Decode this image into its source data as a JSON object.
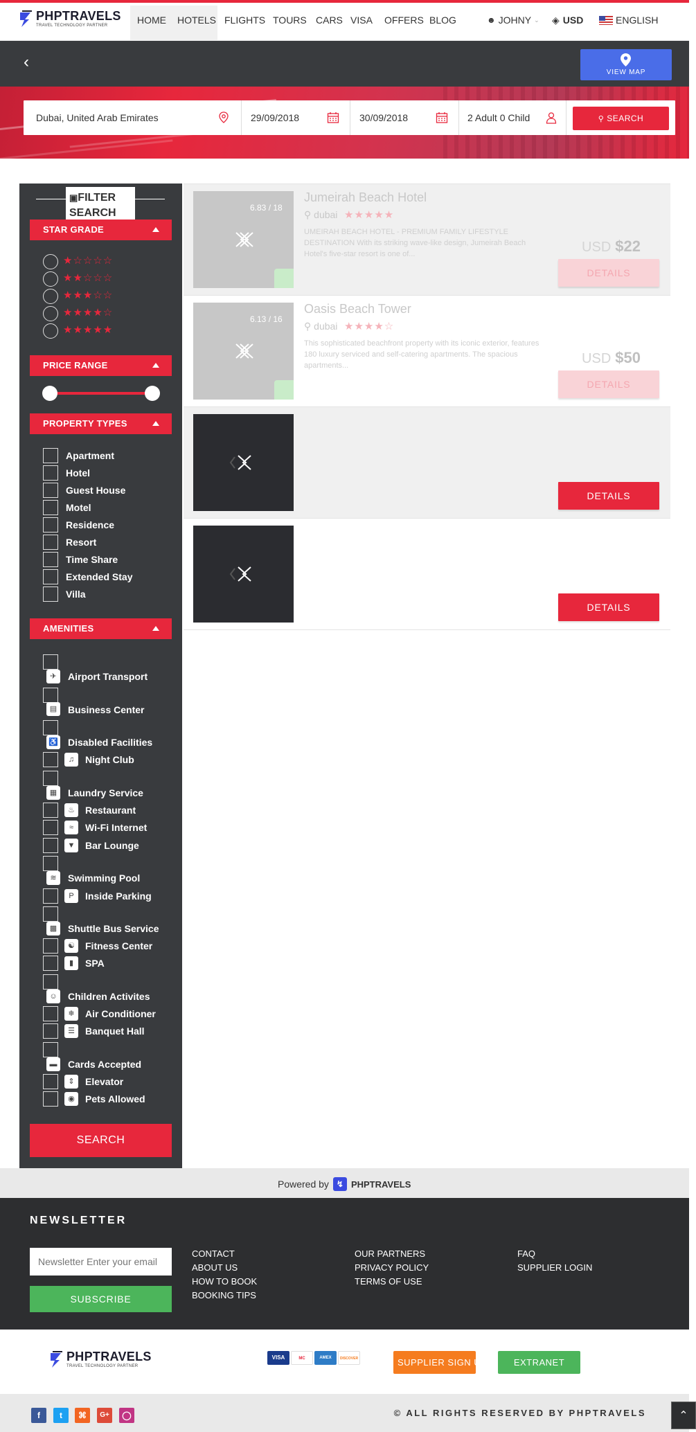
{
  "brand": {
    "name": "PHPTRAVELS",
    "tagline": "TRAVEL TECHNOLOGY PARTNER"
  },
  "nav": {
    "items": [
      "HOME",
      "HOTELS",
      "FLIGHTS",
      "TOURS",
      "CARS",
      "VISA",
      "OFFERS",
      "BLOG"
    ],
    "active": "HOTELS",
    "user": "JOHNY",
    "currency": "USD",
    "language": "ENGLISH"
  },
  "toolbar": {
    "view_map": "VIEW MAP"
  },
  "search": {
    "location": "Dubai, United Arab Emirates",
    "checkin": "29/09/2018",
    "checkout": "30/09/2018",
    "guests": "2 Adult 0 Child",
    "button": "SEARCH"
  },
  "sidebar": {
    "title_line1": "FILTER",
    "title_line2": "SEARCH",
    "star_grade": {
      "label": "STAR GRADE",
      "levels": [
        1,
        2,
        3,
        4,
        5
      ]
    },
    "price_range": {
      "label": "PRICE RANGE",
      "min_fraction": 0,
      "max_fraction": 1
    },
    "property_types": {
      "label": "PROPERTY TYPES",
      "items": [
        "Apartment",
        "Hotel",
        "Guest House",
        "Motel",
        "Residence",
        "Resort",
        "Time Share",
        "Extended Stay",
        "Villa"
      ]
    },
    "amenities": {
      "label": "AMENITIES",
      "items": [
        "Airport Transport",
        "Business Center",
        "Disabled Facilities",
        "Night Club",
        "Laundry Service",
        "Restaurant",
        "Wi-Fi Internet",
        "Bar Lounge",
        "Swimming Pool",
        "Inside Parking",
        "Shuttle Bus Service",
        "Fitness Center",
        "SPA",
        "Children Activites",
        "Air Conditioner",
        "Banquet Hall",
        "Cards Accepted",
        "Elevator",
        "Pets Allowed"
      ]
    },
    "search_button": "SEARCH"
  },
  "results": [
    {
      "name": "Jumeirah Beach Hotel",
      "location": "dubai",
      "stars": 5,
      "score": "6.83 / 18",
      "description": "UMEIRAH BEACH HOTEL - PREMIUM FAMILY LIFESTYLE DESTINATION With its striking wave-like design, Jumeirah Beach Hotel's five-star resort is one of...",
      "currency": "USD",
      "price": "$22",
      "details": "DETAILS"
    },
    {
      "name": "Oasis Beach Tower",
      "location": "dubai",
      "stars": 4,
      "score": "6.13 / 16",
      "description": "This sophisticated beachfront property with its iconic exterior, features 180 luxury serviced and self-catering apartments. The spacious apartments...",
      "currency": "USD",
      "price": "$50",
      "details": "DETAILS"
    },
    {
      "details": "DETAILS"
    },
    {
      "details": "DETAILS"
    }
  ],
  "footer": {
    "powered_by": "Powered by",
    "newsletter_title": "NEWSLETTER",
    "newsletter_placeholder": "Newsletter Enter your email",
    "subscribe": "SUBSCRIBE",
    "links_col1": [
      "CONTACT",
      "ABOUT US",
      "HOW TO BOOK",
      "BOOKING TIPS"
    ],
    "links_col2": [
      "OUR PARTNERS",
      "PRIVACY POLICY",
      "TERMS OF USE"
    ],
    "links_col3": [
      "FAQ",
      "SUPPLIER LOGIN"
    ],
    "cards": [
      "VISA",
      "MC",
      "AMEX",
      "DISCOVER"
    ],
    "supplier_signup": "SUPPLIER SIGN UP",
    "extranet_login": "EXTRANET LOGIN",
    "copyright": "© ALL RIGHTS RESERVED BY PHPTRAVELS"
  },
  "colors": {
    "accent": "#e7273c",
    "dark": "#393b3e",
    "map": "#4a6de8",
    "green": "#4cb55b",
    "orange": "#f57c1f"
  }
}
